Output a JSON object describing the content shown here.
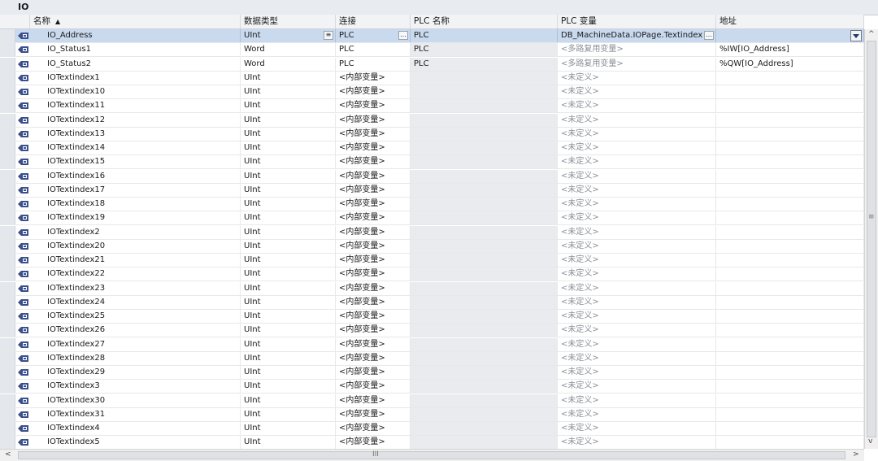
{
  "window": {
    "title": "IO"
  },
  "columns": {
    "name": "名称",
    "datatype": "数据类型",
    "connection": "连接",
    "plc_name": "PLC 名称",
    "plc_tag": "PLC 变量",
    "address": "地址"
  },
  "rows": [
    {
      "name": "IO_Address",
      "datatype": "UInt",
      "connection": "PLC",
      "plc_name": "PLC",
      "plc_tag": "DB_MachineData.IOPage.Textindex",
      "address": "",
      "selected": true
    },
    {
      "name": "IO_Status1",
      "datatype": "Word",
      "connection": "PLC",
      "plc_name": "PLC",
      "plc_tag": "<多路复用变量>",
      "address": "%IW[IO_Address]"
    },
    {
      "name": "IO_Status2",
      "datatype": "Word",
      "connection": "PLC",
      "plc_name": "PLC",
      "plc_tag": "<多路复用变量>",
      "address": "%QW[IO_Address]"
    },
    {
      "name": "IOTextindex1",
      "datatype": "UInt",
      "connection": "<内部变量>",
      "plc_name": "",
      "plc_tag": "<未定义>",
      "address": ""
    },
    {
      "name": "IOTextindex10",
      "datatype": "UInt",
      "connection": "<内部变量>",
      "plc_name": "",
      "plc_tag": "<未定义>",
      "address": ""
    },
    {
      "name": "IOTextindex11",
      "datatype": "UInt",
      "connection": "<内部变量>",
      "plc_name": "",
      "plc_tag": "<未定义>",
      "address": ""
    },
    {
      "name": "IOTextindex12",
      "datatype": "UInt",
      "connection": "<内部变量>",
      "plc_name": "",
      "plc_tag": "<未定义>",
      "address": ""
    },
    {
      "name": "IOTextindex13",
      "datatype": "UInt",
      "connection": "<内部变量>",
      "plc_name": "",
      "plc_tag": "<未定义>",
      "address": ""
    },
    {
      "name": "IOTextindex14",
      "datatype": "UInt",
      "connection": "<内部变量>",
      "plc_name": "",
      "plc_tag": "<未定义>",
      "address": ""
    },
    {
      "name": "IOTextindex15",
      "datatype": "UInt",
      "connection": "<内部变量>",
      "plc_name": "",
      "plc_tag": "<未定义>",
      "address": ""
    },
    {
      "name": "IOTextindex16",
      "datatype": "UInt",
      "connection": "<内部变量>",
      "plc_name": "",
      "plc_tag": "<未定义>",
      "address": ""
    },
    {
      "name": "IOTextindex17",
      "datatype": "UInt",
      "connection": "<内部变量>",
      "plc_name": "",
      "plc_tag": "<未定义>",
      "address": ""
    },
    {
      "name": "IOTextindex18",
      "datatype": "UInt",
      "connection": "<内部变量>",
      "plc_name": "",
      "plc_tag": "<未定义>",
      "address": ""
    },
    {
      "name": "IOTextindex19",
      "datatype": "UInt",
      "connection": "<内部变量>",
      "plc_name": "",
      "plc_tag": "<未定义>",
      "address": ""
    },
    {
      "name": "IOTextindex2",
      "datatype": "UInt",
      "connection": "<内部变量>",
      "plc_name": "",
      "plc_tag": "<未定义>",
      "address": ""
    },
    {
      "name": "IOTextindex20",
      "datatype": "UInt",
      "connection": "<内部变量>",
      "plc_name": "",
      "plc_tag": "<未定义>",
      "address": ""
    },
    {
      "name": "IOTextindex21",
      "datatype": "UInt",
      "connection": "<内部变量>",
      "plc_name": "",
      "plc_tag": "<未定义>",
      "address": ""
    },
    {
      "name": "IOTextindex22",
      "datatype": "UInt",
      "connection": "<内部变量>",
      "plc_name": "",
      "plc_tag": "<未定义>",
      "address": ""
    },
    {
      "name": "IOTextindex23",
      "datatype": "UInt",
      "connection": "<内部变量>",
      "plc_name": "",
      "plc_tag": "<未定义>",
      "address": ""
    },
    {
      "name": "IOTextindex24",
      "datatype": "UInt",
      "connection": "<内部变量>",
      "plc_name": "",
      "plc_tag": "<未定义>",
      "address": ""
    },
    {
      "name": "IOTextindex25",
      "datatype": "UInt",
      "connection": "<内部变量>",
      "plc_name": "",
      "plc_tag": "<未定义>",
      "address": ""
    },
    {
      "name": "IOTextindex26",
      "datatype": "UInt",
      "connection": "<内部变量>",
      "plc_name": "",
      "plc_tag": "<未定义>",
      "address": ""
    },
    {
      "name": "IOTextindex27",
      "datatype": "UInt",
      "connection": "<内部变量>",
      "plc_name": "",
      "plc_tag": "<未定义>",
      "address": ""
    },
    {
      "name": "IOTextindex28",
      "datatype": "UInt",
      "connection": "<内部变量>",
      "plc_name": "",
      "plc_tag": "<未定义>",
      "address": ""
    },
    {
      "name": "IOTextindex29",
      "datatype": "UInt",
      "connection": "<内部变量>",
      "plc_name": "",
      "plc_tag": "<未定义>",
      "address": ""
    },
    {
      "name": "IOTextindex3",
      "datatype": "UInt",
      "connection": "<内部变量>",
      "plc_name": "",
      "plc_tag": "<未定义>",
      "address": ""
    },
    {
      "name": "IOTextindex30",
      "datatype": "UInt",
      "connection": "<内部变量>",
      "plc_name": "",
      "plc_tag": "<未定义>",
      "address": ""
    },
    {
      "name": "IOTextindex31",
      "datatype": "UInt",
      "connection": "<内部变量>",
      "plc_name": "",
      "plc_tag": "<未定义>",
      "address": ""
    },
    {
      "name": "IOTextindex4",
      "datatype": "UInt",
      "connection": "<内部变量>",
      "plc_name": "",
      "plc_tag": "<未定义>",
      "address": ""
    },
    {
      "name": "IOTextindex5",
      "datatype": "UInt",
      "connection": "<内部变量>",
      "plc_name": "",
      "plc_tag": "<未定义>",
      "address": ""
    }
  ],
  "colors": {
    "selected_row": "#c9d9ee",
    "tag_icon": "#3a4f8c",
    "placeholder_text": "#8a8f96"
  },
  "icons": {
    "row": "hmi-tag-icon",
    "sort": "sort-ascending-icon"
  }
}
